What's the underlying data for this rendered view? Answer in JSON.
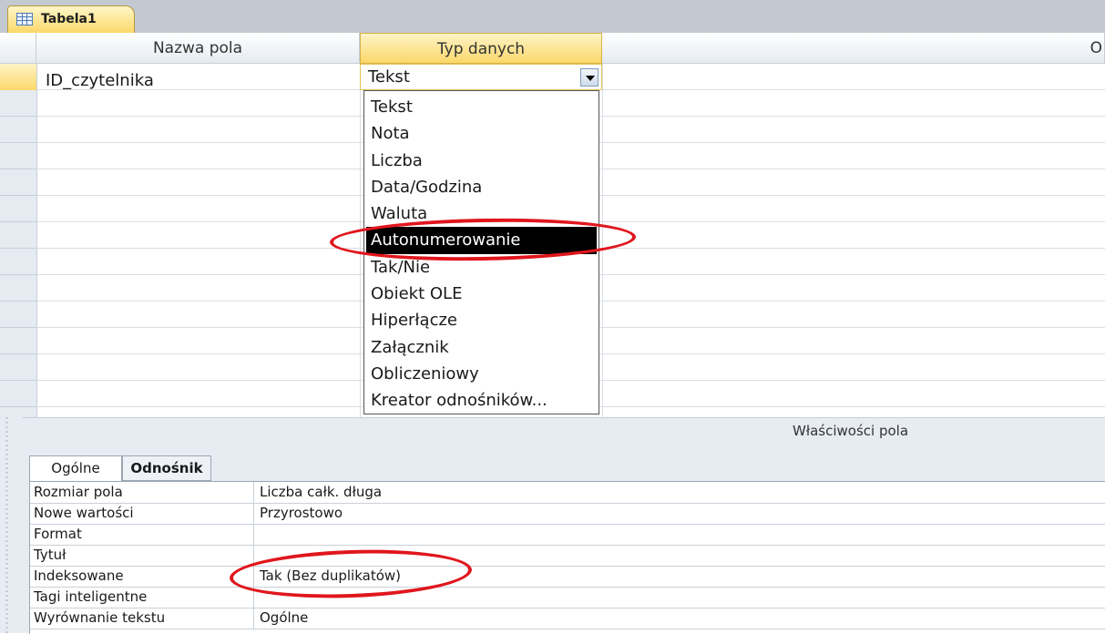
{
  "document_tab": {
    "label": "Tabela1",
    "icon": "table-icon"
  },
  "grid": {
    "columns": [
      "Nazwa pola",
      "Typ danych",
      "O"
    ],
    "rows": [
      {
        "field_name": "ID_czytelnika",
        "data_type": "Tekst"
      }
    ]
  },
  "type_dropdown": {
    "options": [
      "Tekst",
      "Nota",
      "Liczba",
      "Data/Godzina",
      "Waluta",
      "Autonumerowanie",
      "Tak/Nie",
      "Obiekt OLE",
      "Hiperłącze",
      "Załącznik",
      "Obliczeniowy",
      "Kreator odnośników..."
    ],
    "selected": "Autonumerowanie"
  },
  "field_properties": {
    "title": "Właściwości pola",
    "tabs": [
      "Ogólne",
      "Odnośnik"
    ],
    "active_tab": "Ogólne",
    "rows": [
      {
        "label": "Rozmiar pola",
        "value": "Liczba całk. długa"
      },
      {
        "label": "Nowe wartości",
        "value": "Przyrostowo"
      },
      {
        "label": "Format",
        "value": ""
      },
      {
        "label": "Tytuł",
        "value": ""
      },
      {
        "label": "Indeksowane",
        "value": "Tak (Bez duplikatów)"
      },
      {
        "label": "Tagi inteligentne",
        "value": ""
      },
      {
        "label": "Wyrównanie tekstu",
        "value": "Ogólne"
      }
    ]
  },
  "colors": {
    "accent": "#fbd86a",
    "annotation": "#e0161d"
  }
}
